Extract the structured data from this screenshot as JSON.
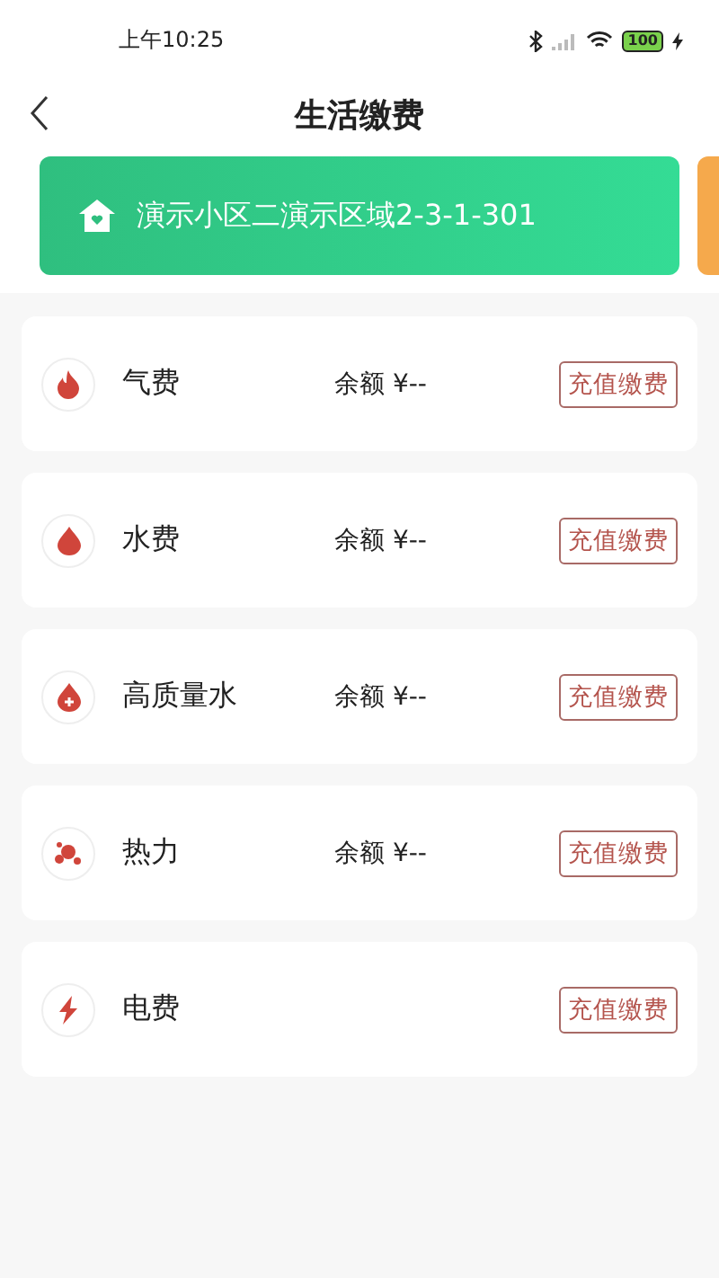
{
  "status_bar": {
    "time": "上午10:25",
    "battery": "100"
  },
  "header": {
    "title": "生活缴费"
  },
  "address_card": {
    "address": "演示小区二演示区域2-3-1-301"
  },
  "utilities": [
    {
      "kind": "gas",
      "name": "气费",
      "balance": "余额 ¥--",
      "button": "充值缴费"
    },
    {
      "kind": "water",
      "name": "水费",
      "balance": "余额 ¥--",
      "button": "充值缴费"
    },
    {
      "kind": "premium-water",
      "name": "高质量水",
      "balance": "余额 ¥--",
      "button": "充值缴费"
    },
    {
      "kind": "heat",
      "name": "热力",
      "balance": "余额 ¥--",
      "button": "充值缴费"
    },
    {
      "kind": "electric",
      "name": "电费",
      "button": "充值缴费"
    }
  ]
}
